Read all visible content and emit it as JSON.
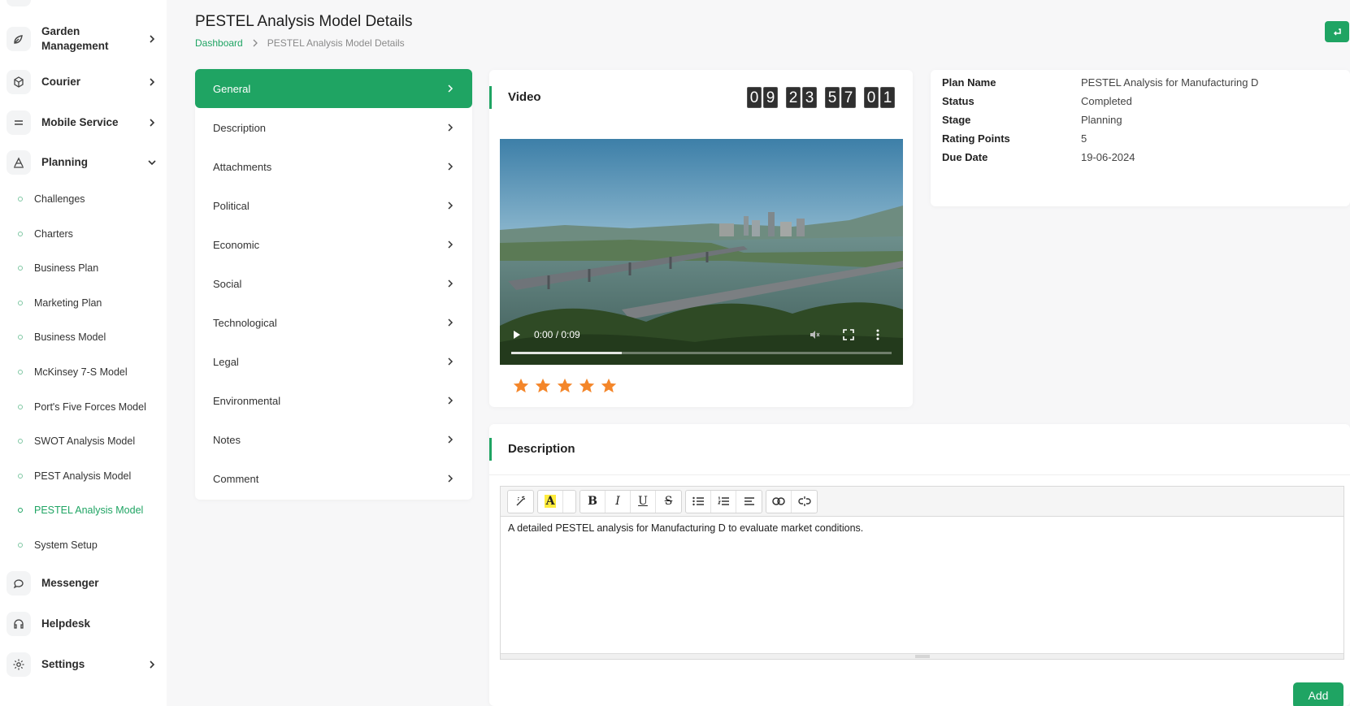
{
  "sidebar": {
    "items": [
      {
        "label": "Garden Management",
        "icon": "plant-icon",
        "chevron": "right"
      },
      {
        "label": "Courier",
        "icon": "box-icon",
        "chevron": "right"
      },
      {
        "label": "Mobile Service",
        "icon": "equals-icon",
        "chevron": "right"
      },
      {
        "label": "Planning",
        "icon": "planning-icon",
        "chevron": "down"
      }
    ],
    "planning_sub": [
      "Challenges",
      "Charters",
      "Business Plan",
      "Marketing Plan",
      "Business Model",
      "McKinsey 7-S Model",
      "Port's Five Forces Model",
      "SWOT Analysis Model",
      "PEST Analysis Model",
      "PESTEL Analysis Model",
      "System Setup"
    ],
    "active_sub": "PESTEL Analysis Model",
    "bottom_items": [
      {
        "label": "Messenger",
        "icon": "chat-icon"
      },
      {
        "label": "Helpdesk",
        "icon": "headset-icon"
      },
      {
        "label": "Settings",
        "icon": "gear-icon",
        "chevron": "right"
      }
    ]
  },
  "header": {
    "title": "PESTEL Analysis Model Details",
    "breadcrumb_home": "Dashboard",
    "breadcrumb_current": "PESTEL Analysis Model Details"
  },
  "tabs": [
    "General",
    "Description",
    "Attachments",
    "Political",
    "Economic",
    "Social",
    "Technological",
    "Legal",
    "Environmental",
    "Notes",
    "Comment"
  ],
  "active_tab": "General",
  "video_card": {
    "title": "Video",
    "countdown": [
      [
        "0",
        "9"
      ],
      [
        "2",
        "3"
      ],
      [
        "5",
        "7"
      ],
      [
        "0",
        "1"
      ]
    ],
    "time": "0:00 / 0:09",
    "progress": 0.29,
    "rating": 5
  },
  "info": [
    {
      "key": "Plan Name",
      "value": "PESTEL Analysis for Manufacturing D"
    },
    {
      "key": "Status",
      "value": "Completed"
    },
    {
      "key": "Stage",
      "value": "Planning"
    },
    {
      "key": "Rating Points",
      "value": "5"
    },
    {
      "key": "Due Date",
      "value": "19-06-2024"
    }
  ],
  "description": {
    "title": "Description",
    "content": "A detailed PESTEL analysis for Manufacturing D to evaluate market conditions.",
    "add_label": "Add"
  },
  "colors": {
    "accent": "#1fa463",
    "star": "#f4862a"
  }
}
